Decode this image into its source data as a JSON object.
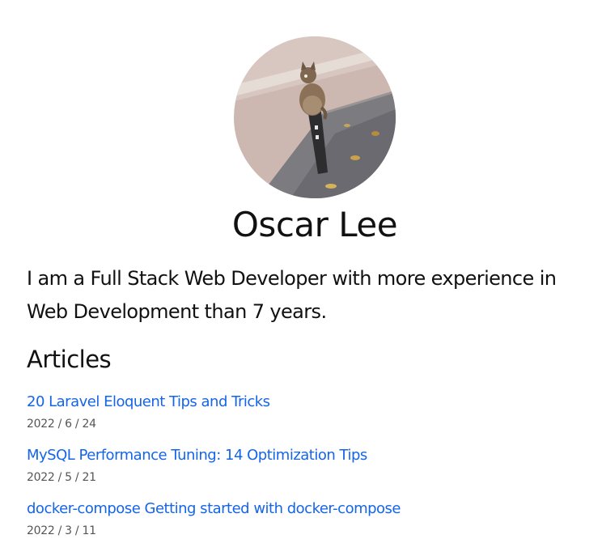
{
  "profile": {
    "avatar_alt": "avatar-photo-cat",
    "name": "Oscar Lee",
    "bio": "I am a Full Stack Web Developer with more experience in Web Development than 7 years."
  },
  "articles": {
    "heading": "Articles",
    "items": [
      {
        "title": "20 Laravel Eloquent Tips and Tricks",
        "date": "2022 / 6 / 24"
      },
      {
        "title": "MySQL Performance Tuning: 14 Optimization Tips",
        "date": "2022 / 5 / 21"
      },
      {
        "title": "docker-compose Getting started with docker-compose",
        "date": "2022 / 3 / 11"
      }
    ]
  },
  "colors": {
    "link": "#1565e8",
    "text": "#111111",
    "muted": "#555555"
  }
}
